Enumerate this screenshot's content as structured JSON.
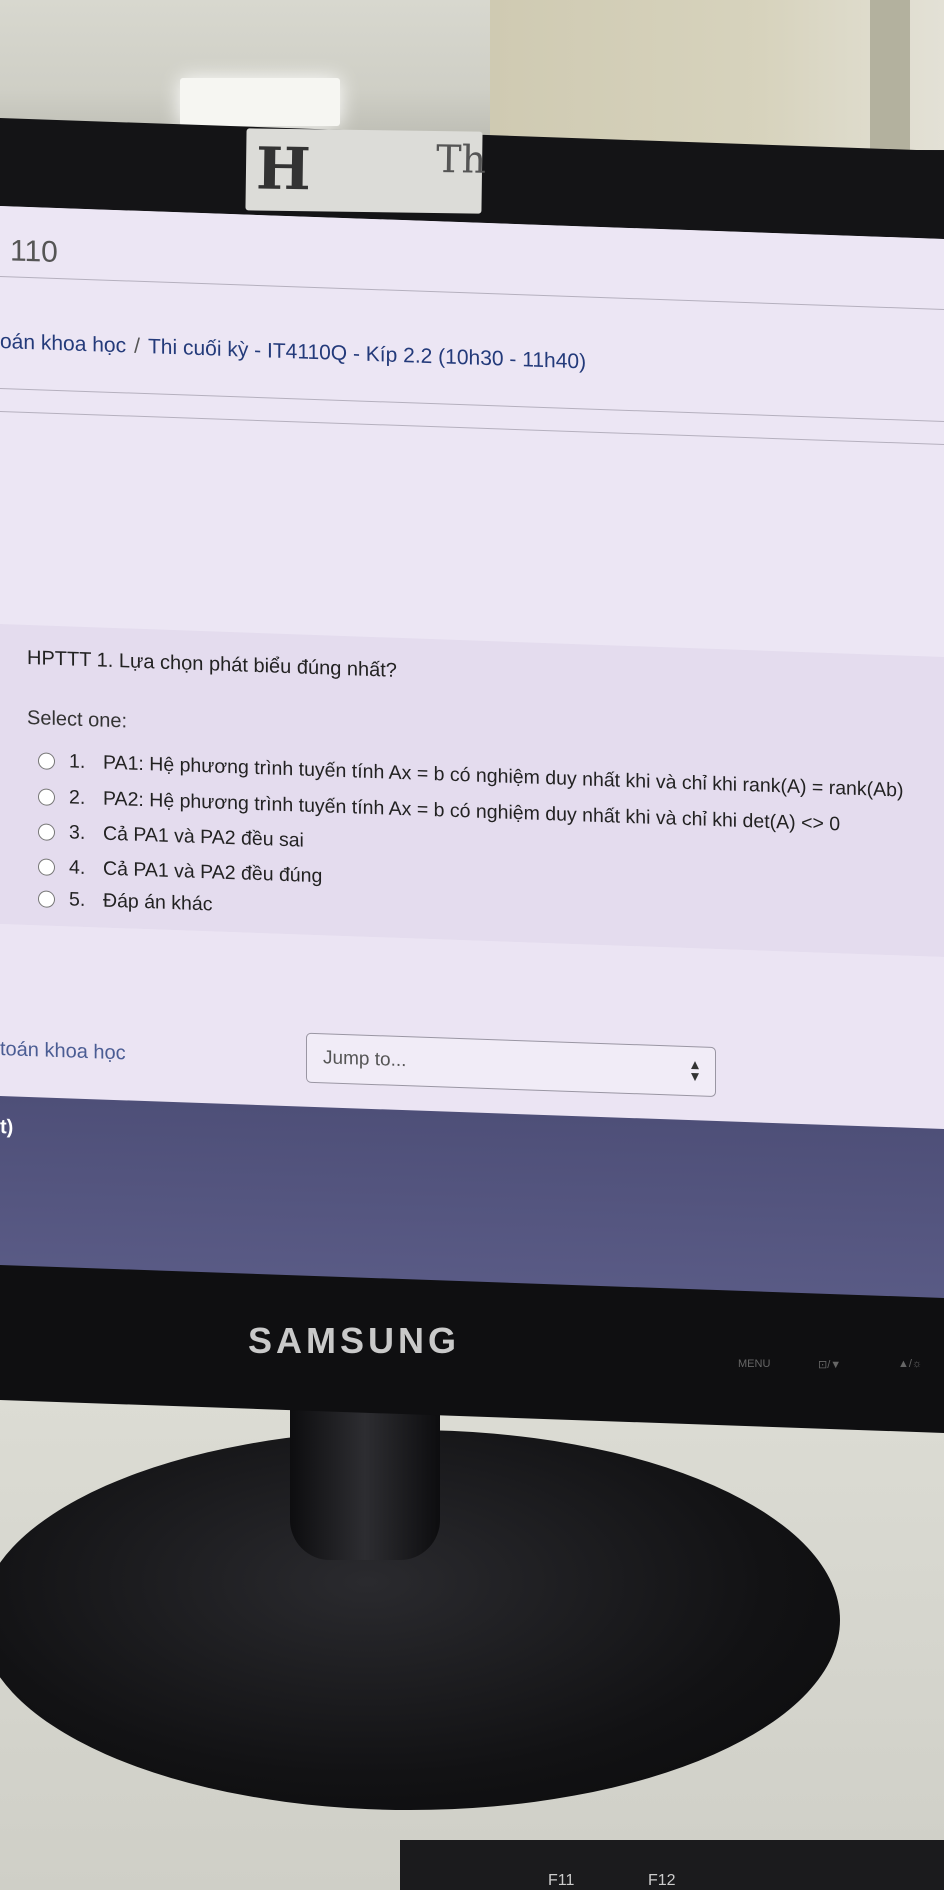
{
  "page": {
    "title_partial": "110",
    "breadcrumb": {
      "course": "oán khoa học",
      "separator": "/",
      "current": "Thi cuối kỳ - IT4110Q - Kíp 2.2 (10h30 - 11h40)"
    }
  },
  "question": {
    "text": "HPTTT 1. Lựa chọn phát biểu đúng nhất?",
    "prompt": "Select one:",
    "options": [
      {
        "num": "1.",
        "label": "PA1: Hệ phương trình tuyến tính Ax = b có nghiệm duy nhất khi và chỉ khi rank(A) = rank(Ab)"
      },
      {
        "num": "2.",
        "label": "PA2: Hệ phương trình tuyến tính Ax = b có nghiệm duy nhất khi và chỉ khi det(A) <> 0"
      },
      {
        "num": "3.",
        "label": "Cả PA1 và PA2 đều sai"
      },
      {
        "num": "4.",
        "label": "Cả PA1 và PA2 đều đúng"
      },
      {
        "num": "5.",
        "label": "Đáp án khác"
      }
    ]
  },
  "navigation": {
    "course_link": "toán khoa học",
    "jump_placeholder": "Jump to...",
    "footer_partial": "t)"
  },
  "monitor": {
    "brand": "SAMSUNG",
    "buttons": [
      "MENU",
      "⊡/▼",
      "▲/☼"
    ],
    "keys": [
      "F11",
      "F12"
    ],
    "sticker_marks": [
      "H",
      "Th"
    ]
  },
  "colors": {
    "screen_bg": "#ebe4f3",
    "question_bg": "#e4dcee",
    "link": "#233a7a",
    "footer": "#545581"
  }
}
